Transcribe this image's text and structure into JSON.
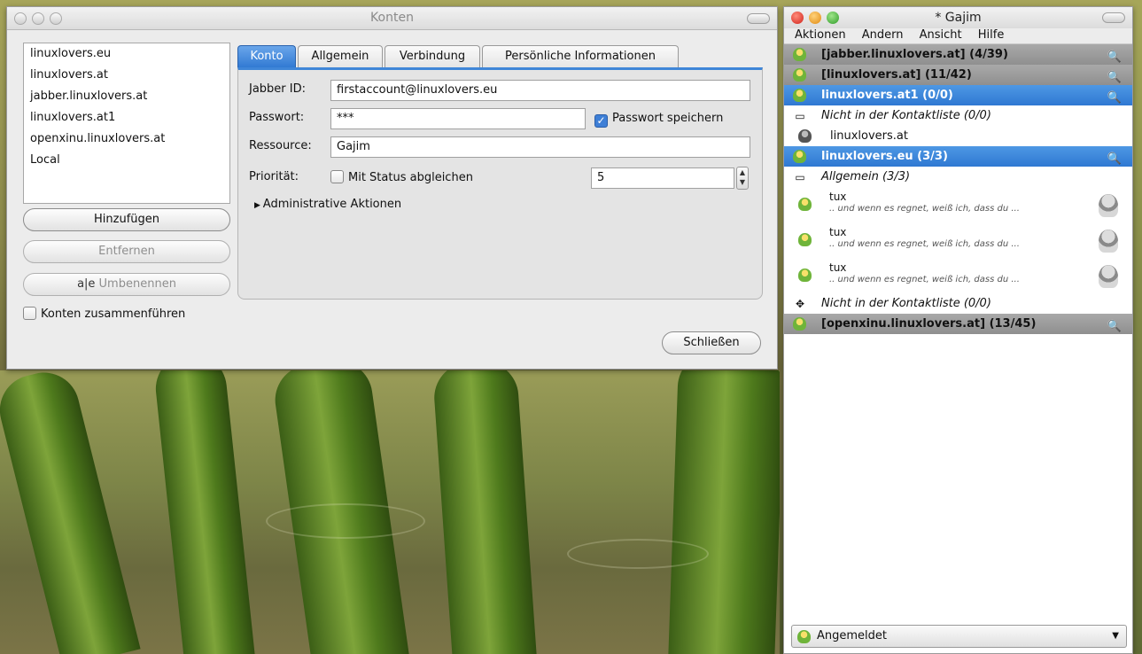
{
  "accounts_window": {
    "title": "Konten",
    "accounts": [
      "linuxlovers.eu",
      "linuxlovers.at",
      "jabber.linuxlovers.at",
      "linuxlovers.at1",
      "openxinu.linuxlovers.at",
      "Local"
    ],
    "add_button": "Hinzufügen",
    "remove_button": "Entfernen",
    "rename_button": "Umbenennen",
    "merge_label": "Konten zusammenführen",
    "close_button": "Schließen",
    "tabs": [
      "Konto",
      "Allgemein",
      "Verbindung",
      "Persönliche Informationen"
    ],
    "form": {
      "jid_label": "Jabber ID:",
      "jid_value": "firstaccount@linuxlovers.eu",
      "password_label": "Passwort:",
      "password_value": "***",
      "save_password_label": "Passwort speichern",
      "resource_label": "Ressource:",
      "resource_value": "Gajim",
      "priority_label": "Priorität:",
      "sync_status_label": "Mit Status abgleichen",
      "priority_value": "5",
      "admin_label": "Administrative Aktionen"
    }
  },
  "gajim": {
    "title": "* Gajim",
    "menu": [
      "Aktionen",
      "Ändern",
      "Ansicht",
      "Hilfe"
    ],
    "accounts": [
      {
        "label": "[jabber.linuxlovers.at] (4/39)"
      },
      {
        "label": "[linuxlovers.at] (11/42)"
      },
      {
        "label": "linuxlovers.at1 (0/0)"
      },
      {
        "label": "Nicht in der Kontaktliste (0/0)"
      },
      {
        "label": "linuxlovers.at"
      },
      {
        "label": "linuxlovers.eu (3/3)"
      },
      {
        "label": "Allgemein (3/3)"
      },
      {
        "label": "Nicht in der Kontaktliste (0/0)"
      },
      {
        "label": "[openxinu.linuxlovers.at] (13/45)"
      }
    ],
    "contacts": [
      {
        "name": "tux",
        "status": ".. und wenn es regnet, weiß ich, dass du ..."
      },
      {
        "name": "tux",
        "status": ".. und wenn es regnet, weiß ich, dass du ..."
      },
      {
        "name": "tux",
        "status": ".. und wenn es regnet, weiß ich, dass du ..."
      }
    ],
    "status": "Angemeldet"
  }
}
